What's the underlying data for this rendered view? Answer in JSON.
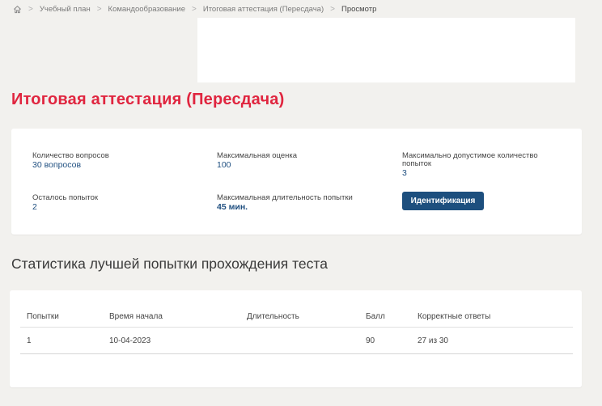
{
  "breadcrumb": {
    "items": [
      "Учебный план",
      "Командообразование",
      "Итоговая аттестация (Пересдача)"
    ],
    "current": "Просмотр"
  },
  "page": {
    "title": "Итоговая аттестация (Пересдача)"
  },
  "info": {
    "questions_label": "Количество вопросов",
    "questions_value": "30 вопросов",
    "max_score_label": "Максимальная оценка",
    "max_score_value": "100",
    "max_attempts_label": "Максимально допустимое количество попыток",
    "max_attempts_value": "3",
    "remaining_label": "Осталось попыток",
    "remaining_value": "2",
    "duration_label": "Максимальная длительность попытки",
    "duration_value": "45 мин.",
    "identify_button": "Идентификация"
  },
  "stats": {
    "title": "Статистика лучшей попытки прохождения теста",
    "columns": [
      "Попытки",
      "Время начала",
      "Длительность",
      "Балл",
      "Корректные ответы"
    ],
    "rows": [
      [
        "1",
        "10-04-2023",
        "",
        "90",
        "27 из 30"
      ]
    ]
  },
  "colors": {
    "accent": "#e0253f",
    "primary": "#1d4f7e",
    "value": "#1f4f80"
  }
}
